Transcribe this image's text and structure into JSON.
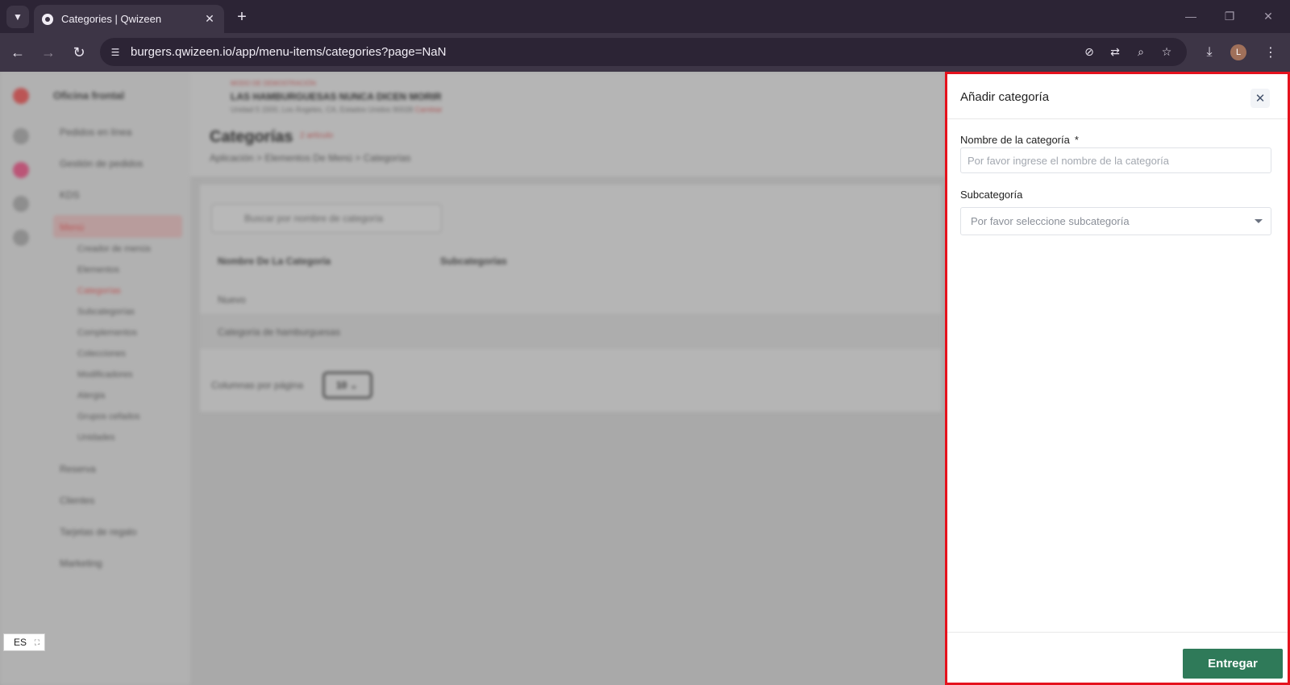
{
  "browser": {
    "tab_title": "Categories | Qwizeen",
    "url": "burgers.qwizeen.io/app/menu-items/categories?page=NaN",
    "profile_initial": "L"
  },
  "app": {
    "brand": "Oficina frontal",
    "header": {
      "tag": "MODO DE DEMOSTRACIÓN",
      "restaurant": "LAS HAMBURGUESAS NUNCA DICEN MORIR",
      "address": "Unidad 5 1500, Los Ángeles, CA, Estados Unidos 90028",
      "address_link": "Cambiar",
      "page_title": "Categorías",
      "page_badge": "2 artículo",
      "breadcrumb": "Aplicación  >  Elementos De Menú  >  Categorías"
    },
    "sidebar": {
      "items": [
        "Pedidos en línea",
        "Gestión de pedidos",
        "KDS",
        "Menú",
        "Reserva",
        "Clientes",
        "Tarjetas de regalo",
        "Marketing"
      ],
      "menu_sub": [
        "Creador de menús",
        "Elementos",
        "Categorías",
        "Subcategorías",
        "Complementos",
        "Colecciones",
        "Modificadores",
        "Alergia",
        "Grupos cefados",
        "Unidades"
      ]
    },
    "table": {
      "search_placeholder": "Buscar por nombre de categoría",
      "col_name": "Nombre De La Categoría",
      "col_sub": "Subcategorías",
      "rows": [
        "Nuevo",
        "Categoría de hamburguesas"
      ],
      "per_page_label": "Columnas por página",
      "per_page_value": "10"
    },
    "language": "ES"
  },
  "drawer": {
    "title": "Añadir categoría",
    "name_label": "Nombre de la categoría",
    "required_mark": "*",
    "name_placeholder": "Por favor ingrese el nombre de la categoría",
    "sub_label": "Subcategoría",
    "sub_placeholder": "Por favor seleccione subcategoría",
    "submit_label": "Entregar"
  },
  "colors": {
    "primary_button": "#2f7a59",
    "highlight_border": "#e5121d"
  }
}
